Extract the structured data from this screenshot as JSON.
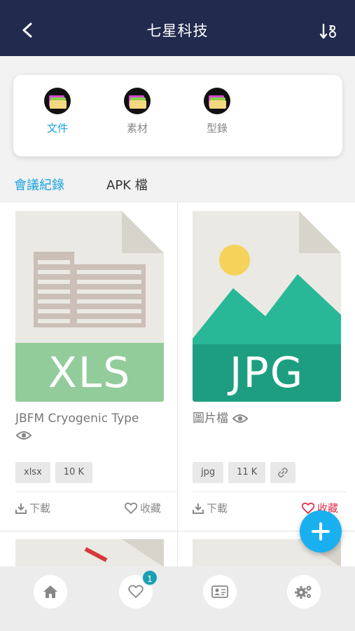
{
  "header": {
    "title": "七星科技",
    "back_icon": "back-arrow-icon",
    "sort_icon": "sort-icon"
  },
  "categories": [
    {
      "label": "文件",
      "active": true
    },
    {
      "label": "素材",
      "active": false
    },
    {
      "label": "型錄",
      "active": false
    }
  ],
  "tabs": [
    {
      "label": "會議紀錄",
      "active": true
    },
    {
      "label": "APK 檔",
      "active": false
    }
  ],
  "files": [
    {
      "thumb_text": "XLS",
      "name": "JBFM Cryogenic Type",
      "tags": [
        "xlsx",
        "10 K"
      ],
      "download_label": "下載",
      "favorite_label": "收藏",
      "favorited": false
    },
    {
      "thumb_text": "JPG",
      "name": "圖片檔",
      "tags": [
        "jpg",
        "11 K"
      ],
      "download_label": "下載",
      "favorite_label": "收藏",
      "favorited": true
    }
  ],
  "bottom_nav": {
    "items": [
      "home-icon",
      "heart-icon",
      "contact-card-icon",
      "settings-icon"
    ],
    "favorites_badge": "1"
  },
  "colors": {
    "header": "#222a4e",
    "accent": "#1aa3e0",
    "xls_green": "#93cc9b",
    "jpg_teal": "#1e9e80",
    "fab": "#1ab0f0"
  }
}
